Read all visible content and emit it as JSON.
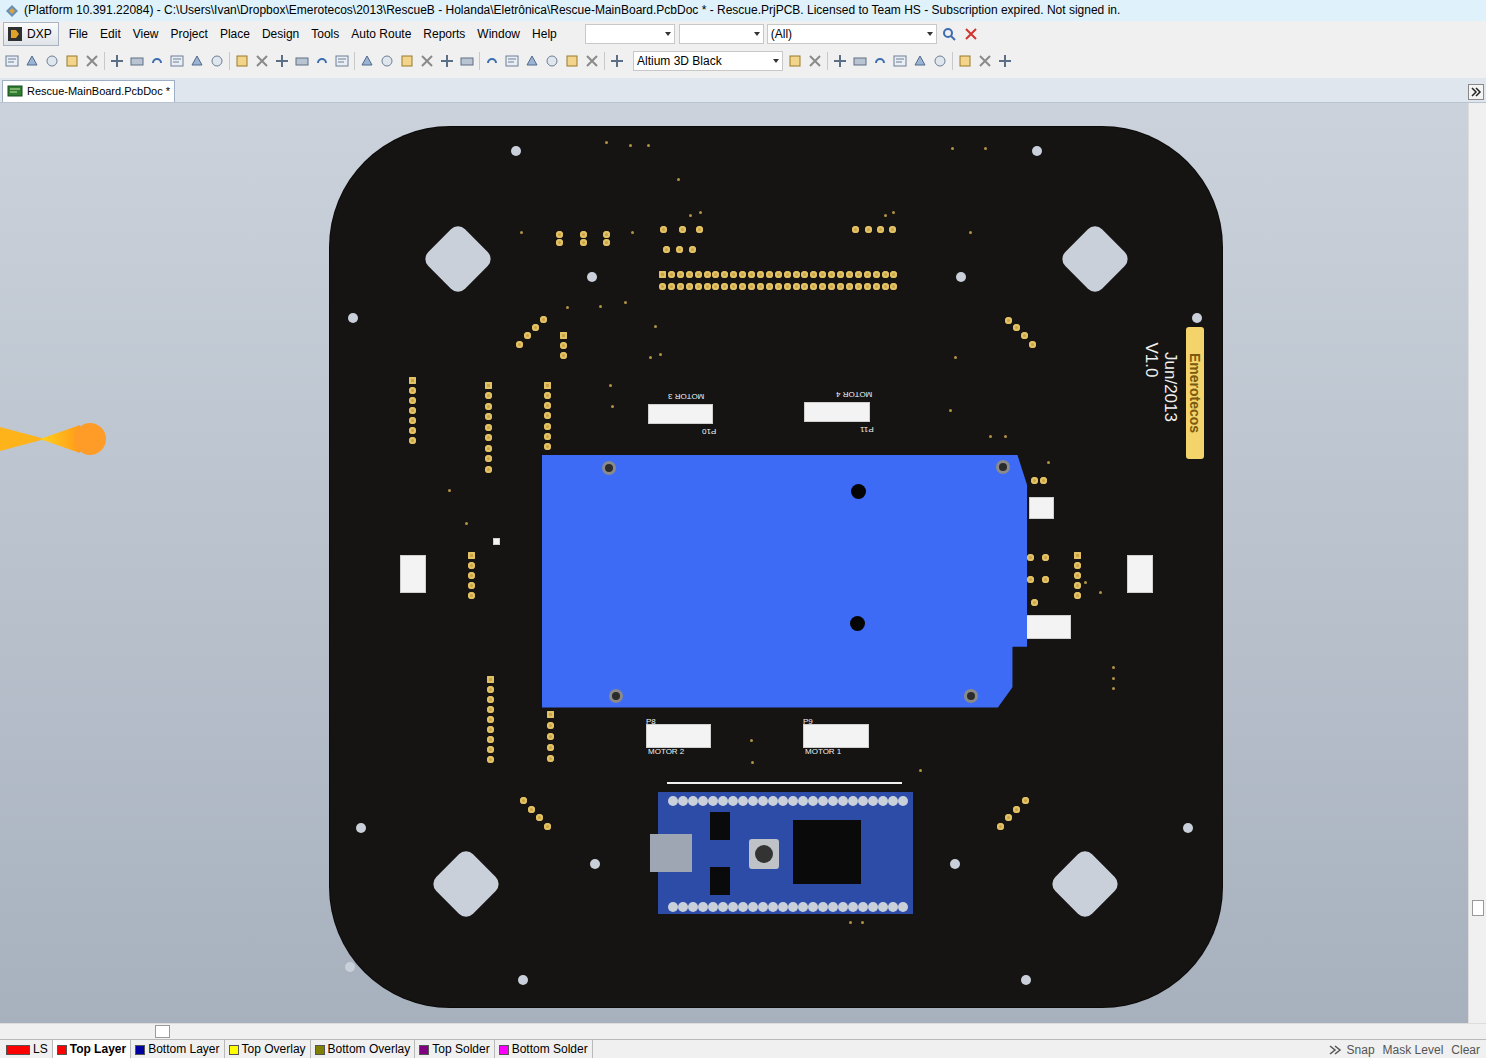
{
  "window": {
    "title": "(Platform 10.391.22084) - C:\\Users\\Ivan\\Dropbox\\Emerotecos\\2013\\RescueB - Holanda\\Eletrônica\\Rescue-MainBoard.PcbDoc * - Rescue.PrjPCB. Licensed to Team HS - Subscription expired. Not signed in."
  },
  "menu": [
    "DXP",
    "File",
    "Edit",
    "View",
    "Project",
    "Place",
    "Design",
    "Tools",
    "Auto Route",
    "Reports",
    "Window",
    "Help"
  ],
  "filter_combo": {
    "value": "(All)"
  },
  "view_config_combo": {
    "value": "Altium 3D Black"
  },
  "document_tab": {
    "label": "Rescue-MainBoard.PcbDoc *",
    "selected": true
  },
  "board": {
    "labels": [
      {
        "text": "MOTOR 3"
      },
      {
        "text": "MOTOR 4"
      },
      {
        "text": "MOTOR 2"
      },
      {
        "text": "MOTOR 1"
      },
      {
        "text": "P10"
      },
      {
        "text": "P11"
      },
      {
        "text": "P8"
      },
      {
        "text": "P9"
      }
    ],
    "logo": "Emerotecos",
    "date": "Jun/2013",
    "version": "V1.0"
  },
  "layer_tabs": [
    {
      "label": "LS",
      "color": "#ff0000",
      "selected": false
    },
    {
      "label": "Top Layer",
      "color": "#ff0000",
      "selected": true
    },
    {
      "label": "Bottom Layer",
      "color": "#0000a0",
      "selected": false
    },
    {
      "label": "Top Overlay",
      "color": "#ffff00",
      "selected": false
    },
    {
      "label": "Bottom Overlay",
      "color": "#808000",
      "selected": false
    },
    {
      "label": "Top Solder",
      "color": "#800080",
      "selected": false
    },
    {
      "label": "Bottom Solder",
      "color": "#ff00ff",
      "selected": false
    }
  ],
  "status_bar": [
    "Snap",
    "Mask Level",
    "Clear"
  ]
}
